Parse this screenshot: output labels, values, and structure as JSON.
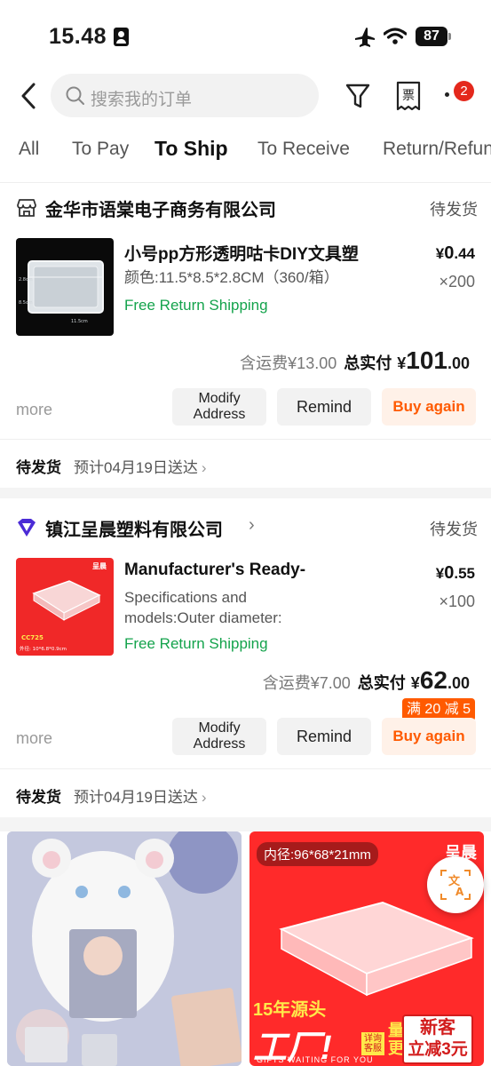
{
  "status_bar": {
    "time": "15.48",
    "battery": "87"
  },
  "header": {
    "search_placeholder": "搜索我的订单",
    "notification_count": "2"
  },
  "tabs": [
    "All",
    "To Pay",
    "To Ship",
    "To Receive",
    "Return/Refund"
  ],
  "active_tab": "To Ship",
  "orders": [
    {
      "store": "金华市语棠电子商务有限公司",
      "status": "待发货",
      "title": "小号pp方形透明咕卡DIY文具塑",
      "spec": "颜色:11.5*8.5*2.8CM（360/箱）",
      "free_return": "Free Return Shipping",
      "price_cur": "¥",
      "price_int": "0",
      "price_dec": ".44",
      "qty": "×200",
      "shipping_fee": "含运费¥13.00",
      "total_label": "总实付",
      "total_cur": "¥",
      "total_int": "101",
      "total_dec": ".00",
      "more": "more",
      "btn_modify": "Modify Address",
      "btn_remind": "Remind",
      "btn_buy": "Buy again",
      "ship_label": "待发货",
      "ship_estimate": "预计04月19日送达",
      "thumb_dims": [
        "11.5cm",
        "8.5cm",
        "2.8cm"
      ]
    },
    {
      "store": "镇江呈晨塑料有限公司",
      "status": "待发货",
      "title": "Manufacturer's Ready-",
      "spec": "Specifications and models:Outer diameter:",
      "free_return": "Free Return Shipping",
      "price_cur": "¥",
      "price_int": "0",
      "price_dec": ".55",
      "qty": "×100",
      "shipping_fee": "含运费¥7.00",
      "total_label": "总实付",
      "total_cur": "¥",
      "total_int": "62",
      "total_dec": ".00",
      "more": "more",
      "btn_modify": "Modify Address",
      "btn_remind": "Remind",
      "btn_buy": "Buy again",
      "promo": "满 20 减 5",
      "ship_label": "待发货",
      "ship_estimate": "预计04月19日送达",
      "thumb_brand": "呈晨",
      "thumb_code": "CC725",
      "thumb_size": "外径: 10*6.8*0.9cm"
    }
  ],
  "recommendations": {
    "right": {
      "inner_diameter": "内径:96*68*21mm",
      "brand": "呈晨",
      "slogan": "15年源头",
      "factory": "工厂!",
      "service": "详询客服",
      "offer_l1": "量大",
      "offer_l2": "更优惠",
      "new_l1": "新客",
      "new_l2": "立减3元",
      "gift": "GIFTS WAITING FOR YOU"
    }
  },
  "colors": {
    "accent": "#ff5a00",
    "green": "#14a34c",
    "badge": "#e4281c"
  }
}
